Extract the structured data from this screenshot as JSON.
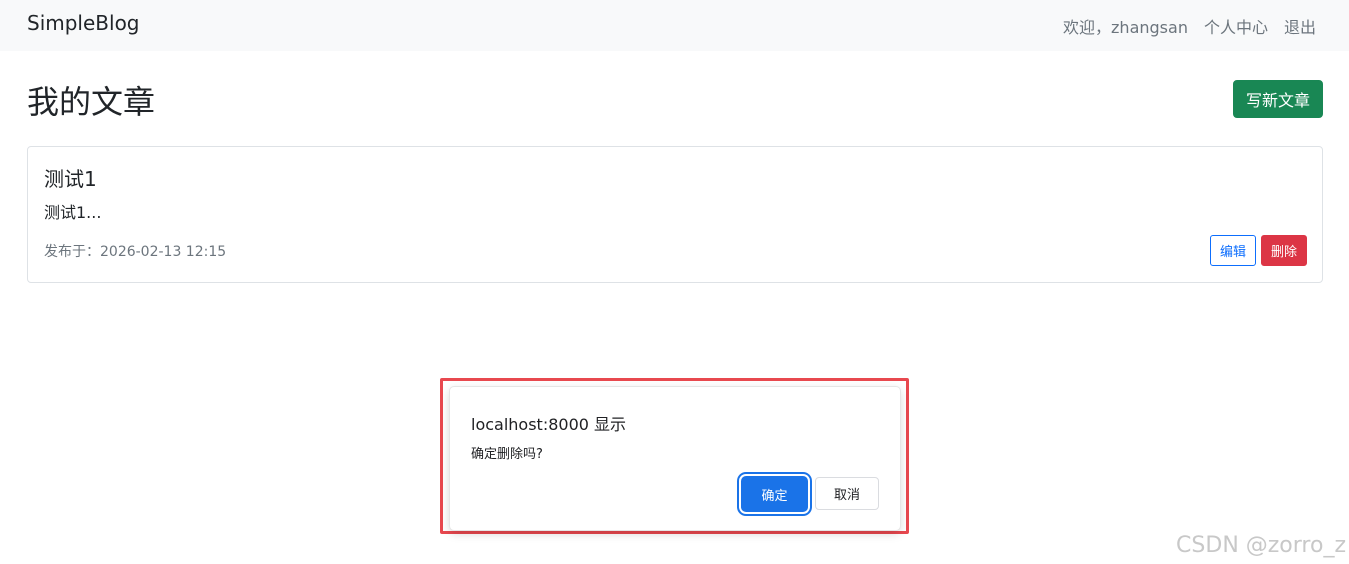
{
  "navbar": {
    "brand": "SimpleBlog",
    "welcome": "欢迎，zhangsan",
    "profile": "个人中心",
    "logout": "退出"
  },
  "page": {
    "title": "我的文章",
    "new_post_label": "写新文章"
  },
  "posts": [
    {
      "title": "测试1",
      "excerpt": "测试1...",
      "meta": "发布于：2026-02-13 12:15",
      "edit_label": "编辑",
      "delete_label": "删除"
    }
  ],
  "dialog": {
    "origin": "localhost:8000 显示",
    "message": "确定删除吗?",
    "ok_label": "确定",
    "cancel_label": "取消"
  },
  "watermark": "CSDN @zorro_z",
  "colors": {
    "success": "#198754",
    "primary": "#0d6efd",
    "danger": "#dc3545",
    "dialog_ok": "#1a73e8",
    "highlight": "#e8484f"
  }
}
